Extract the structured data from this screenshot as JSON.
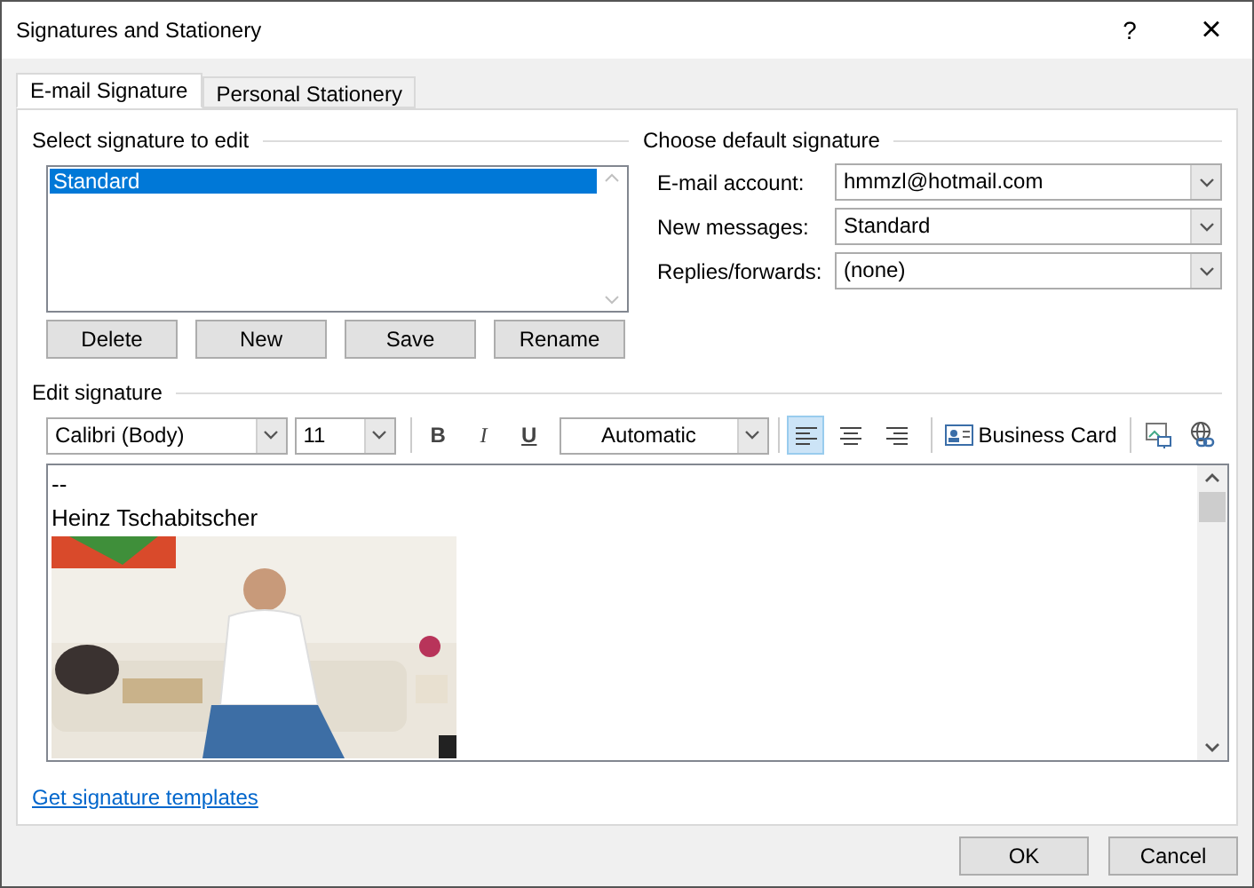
{
  "window": {
    "title": "Signatures and Stationery",
    "help": "?",
    "close": "×"
  },
  "tabs": [
    {
      "label": "E-mail Signature",
      "selected": true
    },
    {
      "label": "Personal Stationery",
      "selected": false
    }
  ],
  "select_signature": {
    "heading": "Select signature to edit",
    "items": [
      {
        "label": "Standard",
        "selected": true
      }
    ],
    "buttons": [
      "Delete",
      "New",
      "Save",
      "Rename"
    ]
  },
  "default_signature": {
    "heading": "Choose default signature",
    "fields": [
      {
        "label": "E-mail account:",
        "value": "hmmzl@hotmail.com"
      },
      {
        "label": "New messages:",
        "value": "Standard"
      },
      {
        "label": "Replies/forwards:",
        "value": "(none)"
      }
    ]
  },
  "edit_signature": {
    "heading": "Edit signature",
    "toolbar": {
      "font": "Calibri (Body)",
      "size": "11",
      "bold": "B",
      "italic": "I",
      "underline": "U",
      "font_color_label": "Automatic",
      "alignments": [
        {
          "kind": "left",
          "selected": true
        },
        {
          "kind": "center",
          "selected": false
        },
        {
          "kind": "right",
          "selected": false
        }
      ],
      "business_card": "Business Card"
    },
    "lines": [
      "--",
      "Heinz Tschabitscher"
    ],
    "content": [
      {
        "kind": "picture"
      }
    ]
  },
  "link": "Get signature templates",
  "buttons": [
    "OK",
    "Cancel"
  ]
}
